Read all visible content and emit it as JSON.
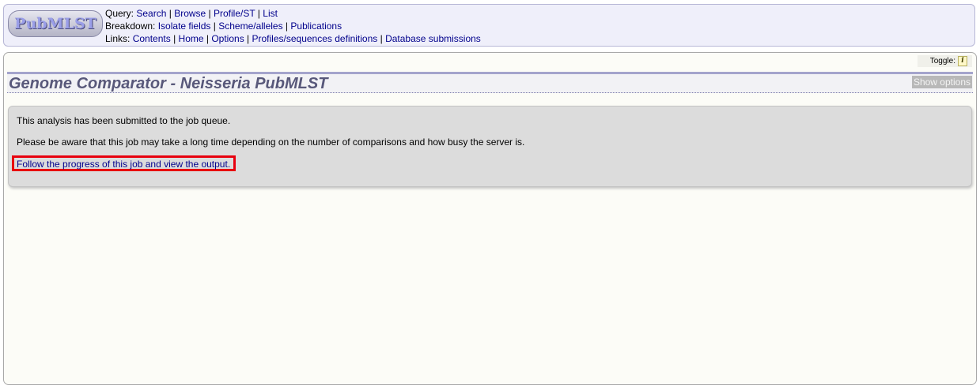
{
  "logo": {
    "text": "PubMLST"
  },
  "nav": {
    "query": {
      "label": "Query:",
      "links": [
        "Search",
        "Browse",
        "Profile/ST",
        "List"
      ]
    },
    "breakdown": {
      "label": "Breakdown:",
      "links": [
        "Isolate fields",
        "Scheme/alleles",
        "Publications"
      ]
    },
    "links": {
      "label": "Links:",
      "links": [
        "Contents",
        "Home",
        "Options",
        "Profiles/sequences definitions",
        "Database submissions"
      ]
    },
    "separator": " | "
  },
  "toggle": {
    "label": "Toggle:",
    "icon": "i"
  },
  "page": {
    "title": "Genome Comparator - Neisseria PubMLST",
    "show_options": "Show options"
  },
  "message": {
    "line1": "This analysis has been submitted to the job queue.",
    "line2": "Please be aware that this job may take a long time depending on the number of comparisons and how busy the server is.",
    "link": "Follow the progress of this job and view the output."
  },
  "colors": {
    "link": "#00008b",
    "highlight_border": "#e8000e",
    "header_bg": "#efeffa",
    "title_text": "#58587a"
  }
}
